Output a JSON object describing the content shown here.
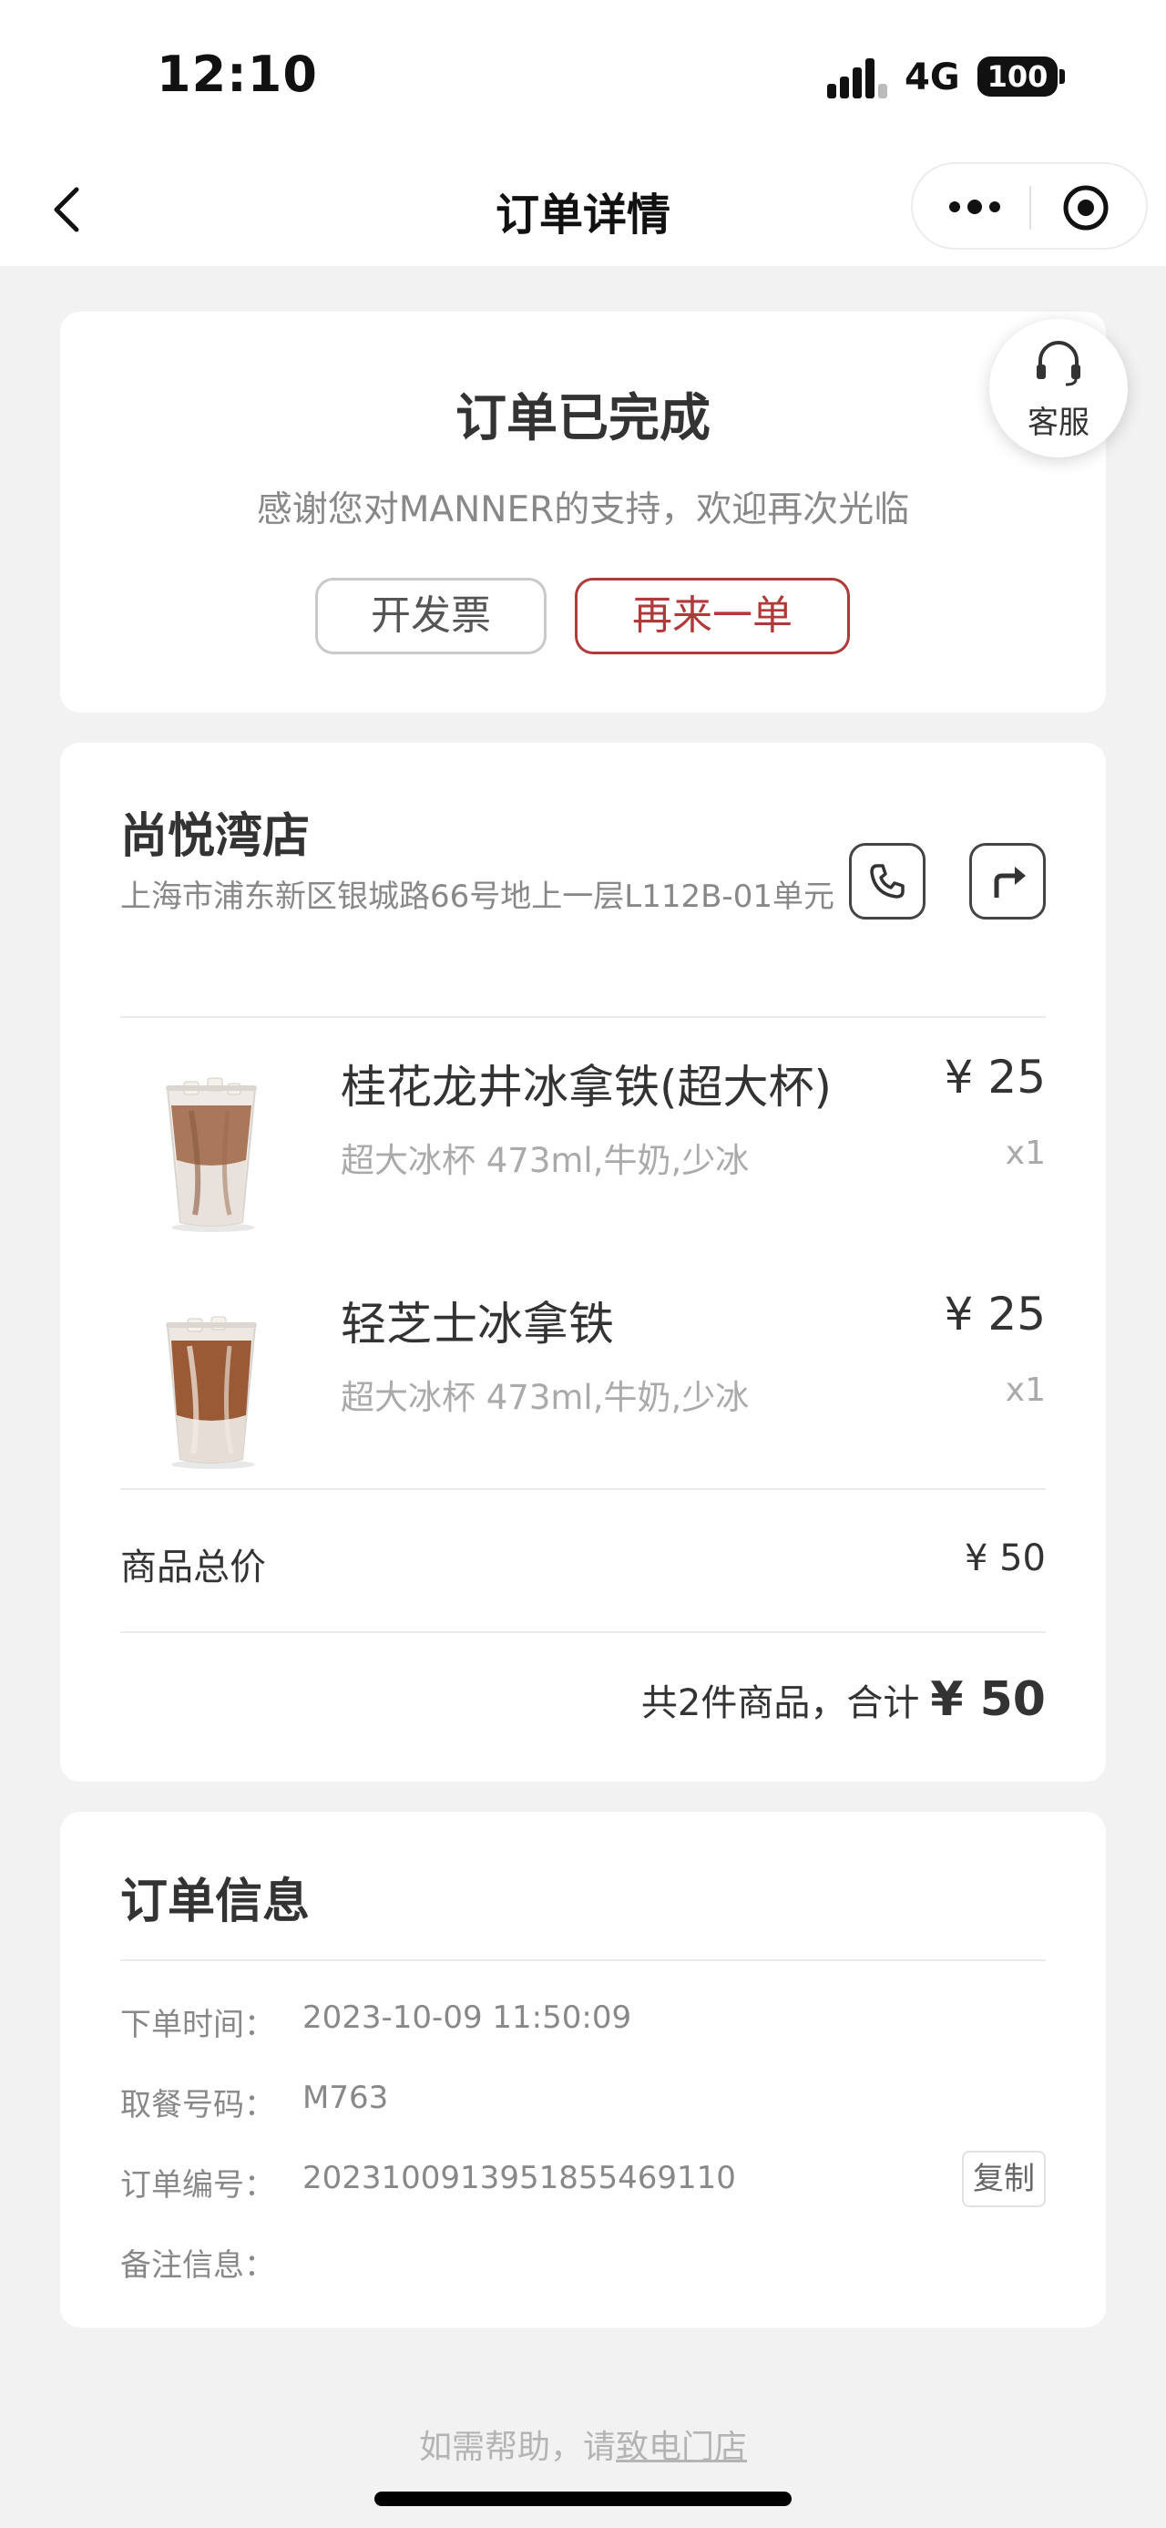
{
  "status_bar": {
    "time": "12:10",
    "network": "4G",
    "battery": "100"
  },
  "nav": {
    "title": "订单详情",
    "back_icon": "chevron-left-icon",
    "more_icon": "more-dots-icon",
    "close_icon": "target-circle-icon"
  },
  "status_card": {
    "title": "订单已完成",
    "subtitle": "感谢您对MANNER的支持，欢迎再次光临",
    "invoice_button": "开发票",
    "reorder_button": "再来一单",
    "accent_color": "#b03a3a"
  },
  "service": {
    "label": "客服",
    "icon": "headset-icon"
  },
  "store": {
    "name": "尚悦湾店",
    "address": "上海市浦东新区银城路66号地上一层L112B-01单元",
    "phone_icon": "phone-icon",
    "navigate_icon": "route-arrow-icon"
  },
  "items": [
    {
      "name": "桂花龙井冰拿铁(超大杯)",
      "spec": "超大冰杯 473ml,牛奶,少冰",
      "price": "¥ 25",
      "qty": "x1",
      "image": "iced-latte-cup-image"
    },
    {
      "name": "轻芝士冰拿铁",
      "spec": "超大冰杯 473ml,牛奶,少冰",
      "price": "¥ 25",
      "qty": "x1",
      "image": "iced-latte-cup-image"
    }
  ],
  "summary": {
    "subtotal_label": "商品总价",
    "subtotal_value": "¥ 50",
    "total_text": "共2件商品，合计",
    "total_value": "¥ 50"
  },
  "order_info": {
    "title": "订单信息",
    "rows": [
      {
        "label": "下单时间：",
        "value": "2023-10-09 11:50:09"
      },
      {
        "label": "取餐号码：",
        "value": "M763"
      },
      {
        "label": "订单编号：",
        "value": "20231009139518554691​10"
      },
      {
        "label": "备注信息：",
        "value": ""
      }
    ],
    "copy_button": "复制"
  },
  "footer": {
    "help_prefix": "如需帮助，请",
    "help_link": "致电门店"
  }
}
